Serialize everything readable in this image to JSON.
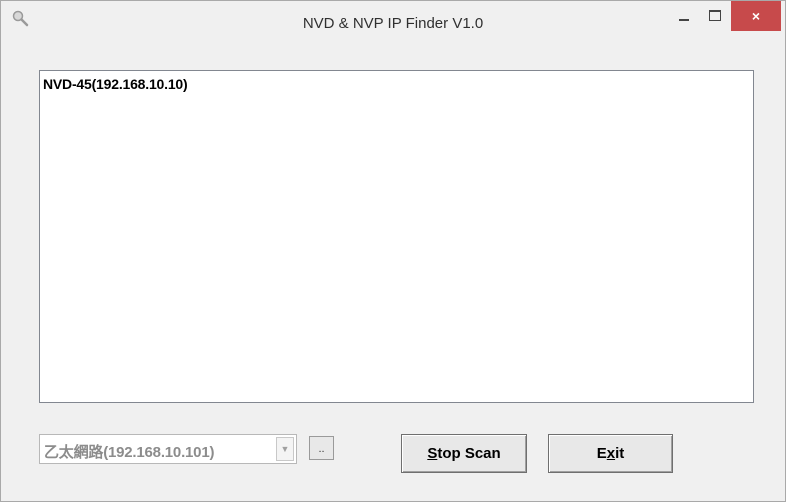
{
  "window": {
    "title": "NVD & NVP IP Finder V1.0",
    "close_glyph": "×"
  },
  "device_list": {
    "items": [
      "NVD-45(192.168.10.10)"
    ]
  },
  "network_select": {
    "selected": "乙太網路(192.168.10.101)",
    "arrow_glyph": "▼"
  },
  "browse_button": {
    "label": ".."
  },
  "stop_scan_button": {
    "mnemonic": "S",
    "rest": "top Scan"
  },
  "exit_button": {
    "pre": "E",
    "mnemonic": "x",
    "post": "it"
  },
  "icons": {
    "app": "magnifier-icon",
    "minimize": "minimize-icon",
    "maximize": "maximize-icon",
    "close": "close-icon"
  }
}
